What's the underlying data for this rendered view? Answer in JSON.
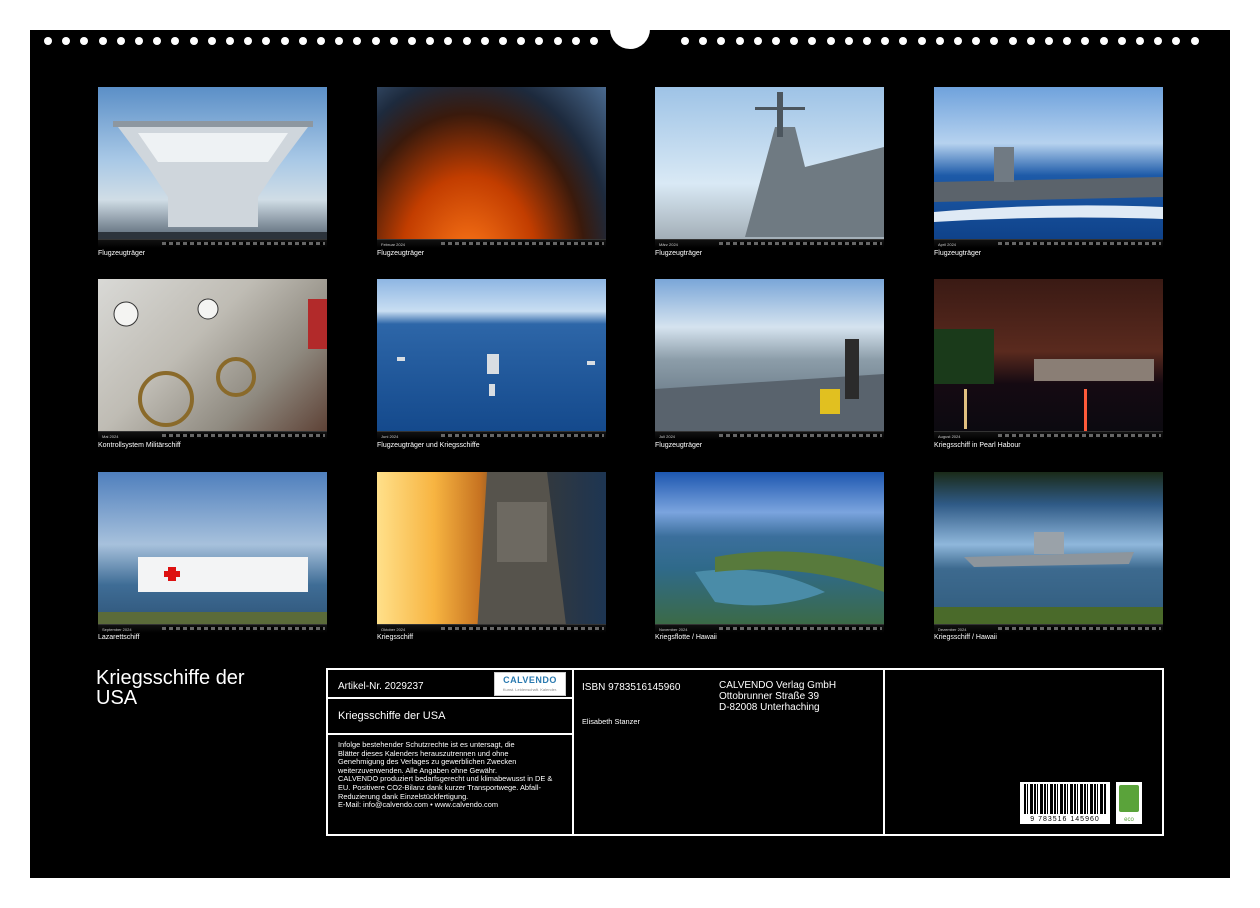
{
  "calendar": {
    "title": "Kriegsschiffe der USA",
    "months": [
      {
        "month_label": "",
        "caption": "Flugzeugträger"
      },
      {
        "month_label": "Februar 2024",
        "caption": "Flugzeugträger"
      },
      {
        "month_label": "März 2024",
        "caption": "Flugzeugträger"
      },
      {
        "month_label": "April 2024",
        "caption": "Flugzeugträger"
      },
      {
        "month_label": "Mai 2024",
        "caption": "Kontrollsystem Militärschiff"
      },
      {
        "month_label": "Juni 2024",
        "caption": "Flugzeugträger und Kriegsschiffe"
      },
      {
        "month_label": "Juli 2024",
        "caption": "Flugzeugträger"
      },
      {
        "month_label": "August 2024",
        "caption": "Kriegsschiff in Pearl Habour"
      },
      {
        "month_label": "September 2024",
        "caption": "Lazarettschiff"
      },
      {
        "month_label": "Oktober 2024",
        "caption": "Kriegsschiff"
      },
      {
        "month_label": "November 2024",
        "caption": "Kriegsflotte / Hawaii"
      },
      {
        "month_label": "Dezember 2024",
        "caption": "Kriegsschiff / Hawaii"
      }
    ]
  },
  "info_box": {
    "article_no": "Artikel-Nr. 2029237",
    "logo_name": "CALVENDO",
    "logo_tag": "Kunst. Leidenschaft. Kalender.",
    "product_title": "Kriegsschiffe der USA",
    "notice_lines": [
      "Infolge bestehender Schutzrechte ist es untersagt, die",
      "Blätter dieses Kalenders herauszutrennen und ohne",
      "Genehmigung des Verlages zu gewerblichen Zwecken",
      "weiterzuverwenden. Alle Angaben ohne Gewähr.",
      "CALVENDO produziert bedarfsgerecht und klimabewusst in DE &",
      "EU. Positivere CO2-Bilanz dank kurzer Transportwege. Abfall-",
      "Reduzierung dank Einzelstückfertigung.",
      "E-Mail: info@calvendo.com • www.calvendo.com"
    ],
    "isbn": "ISBN 9783516145960",
    "author": "Elisabeth Stanzer",
    "publisher_lines": [
      "CALVENDO Verlag GmbH",
      "Ottobrunner Straße 39",
      "D-82008 Unterhaching"
    ],
    "barcode_number": "9 783516 145960",
    "eco_label": "eco"
  }
}
